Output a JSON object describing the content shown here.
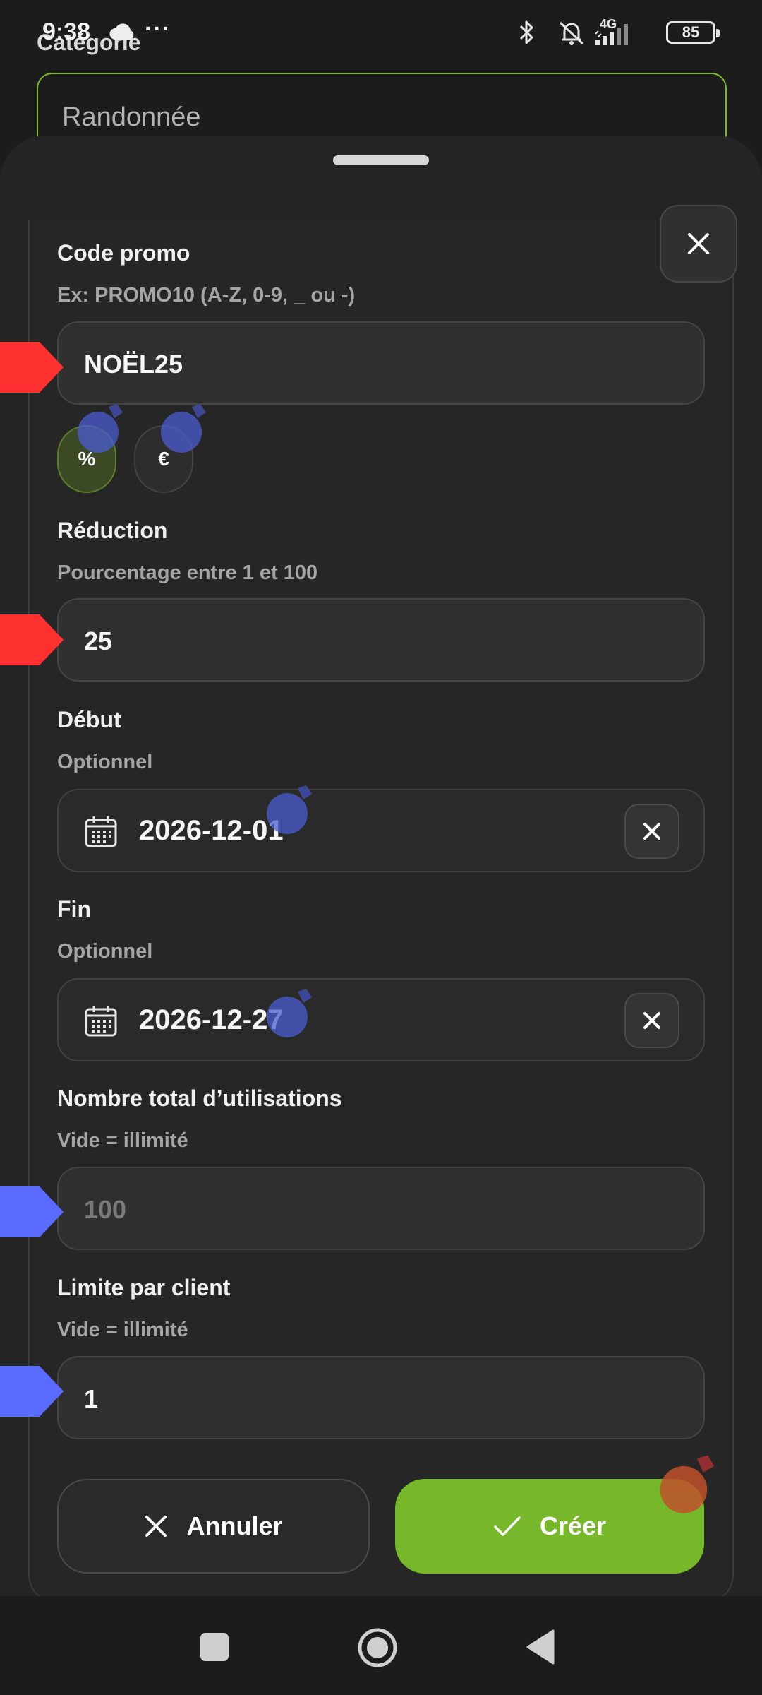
{
  "status_bar": {
    "time": "9:38",
    "dots": "···",
    "network": "4G",
    "battery": "85",
    "icons": [
      "cloud-icon",
      "bluetooth-icon",
      "bell-muted-icon",
      "signal-icon",
      "battery-icon"
    ]
  },
  "background_form": {
    "label": "Catégorie",
    "value": "Randonnée",
    "accent_color": "#7bb829"
  },
  "sheet": {
    "close_icon": "close-icon",
    "promo_code": {
      "label": "Code promo",
      "hint": "Ex: PROMO10 (A-Z, 0-9, _ ou -)",
      "value": "NOËL25"
    },
    "discount_type": {
      "options": [
        "%",
        "€"
      ],
      "selected": "%"
    },
    "reduction": {
      "label": "Réduction",
      "hint": "Pourcentage entre 1 et 100",
      "value": "25"
    },
    "start": {
      "label": "Début",
      "hint": "Optionnel",
      "value": "2026-12-01"
    },
    "end": {
      "label": "Fin",
      "hint": "Optionnel",
      "value": "2026-12-27"
    },
    "total_uses": {
      "label": "Nombre total d’utilisations",
      "hint": "Vide = illimité",
      "value": "",
      "placeholder": "100"
    },
    "per_client": {
      "label": "Limite par client",
      "hint": "Vide = illimité",
      "value": "1"
    },
    "actions": {
      "cancel": "Annuler",
      "create": "Créer"
    }
  },
  "colors": {
    "accent_green": "#76b82a",
    "marker_red": "#ff3030",
    "marker_blue": "#5a6cff"
  }
}
